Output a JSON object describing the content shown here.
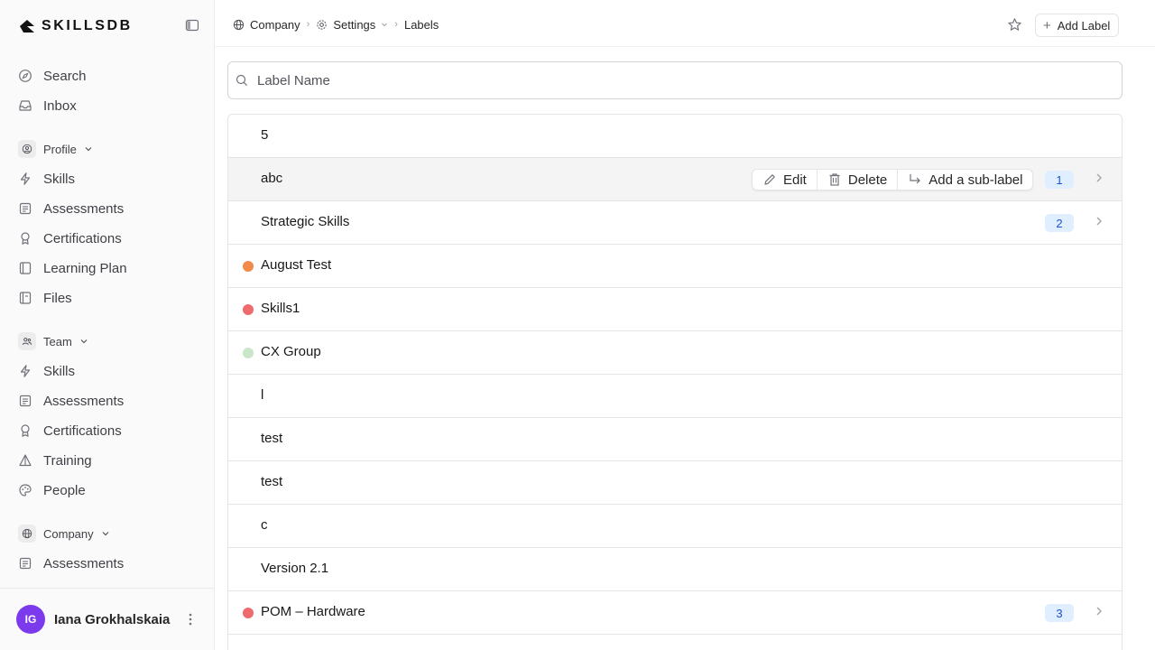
{
  "brand": {
    "logo_text": "SKILLSDB"
  },
  "sidebar": {
    "top_items": [
      {
        "label": "Search",
        "icon": "compass-icon"
      },
      {
        "label": "Inbox",
        "icon": "inbox-icon"
      }
    ],
    "profile": {
      "header": "Profile",
      "items": [
        {
          "label": "Skills",
          "icon": "bolt-icon"
        },
        {
          "label": "Assessments",
          "icon": "assessment-icon"
        },
        {
          "label": "Certifications",
          "icon": "award-icon"
        },
        {
          "label": "Learning Plan",
          "icon": "book-icon"
        },
        {
          "label": "Files",
          "icon": "file-icon"
        }
      ]
    },
    "team": {
      "header": "Team",
      "items": [
        {
          "label": "Skills",
          "icon": "bolt-icon"
        },
        {
          "label": "Assessments",
          "icon": "assessment-icon"
        },
        {
          "label": "Certifications",
          "icon": "award-icon"
        },
        {
          "label": "Training",
          "icon": "triangle-icon"
        },
        {
          "label": "People",
          "icon": "palette-icon"
        }
      ]
    },
    "company": {
      "header": "Company",
      "items": [
        {
          "label": "Assessments",
          "icon": "assessment-icon"
        }
      ]
    },
    "user": {
      "initials": "IG",
      "name": "Iana Grokhalskaia",
      "avatar_color": "#7c3aed"
    }
  },
  "header": {
    "breadcrumb": [
      "Company",
      "Settings",
      "Labels"
    ],
    "add_label": "Add Label"
  },
  "search": {
    "placeholder": "Label Name",
    "value": ""
  },
  "row_actions": {
    "edit": "Edit",
    "delete": "Delete",
    "add_sub": "Add a sub-label"
  },
  "labels": [
    {
      "name": "5",
      "color": null,
      "count": null
    },
    {
      "name": "abc",
      "color": null,
      "count": "1",
      "hovered": true
    },
    {
      "name": "Strategic Skills",
      "color": null,
      "count": "2"
    },
    {
      "name": "August Test",
      "color": "#f28a4a",
      "count": null
    },
    {
      "name": "Skills1",
      "color": "#f06b6b",
      "count": null
    },
    {
      "name": "CX Group",
      "color": "#c9e6c9",
      "count": null
    },
    {
      "name": "l",
      "color": null,
      "count": null
    },
    {
      "name": "test",
      "color": null,
      "count": null
    },
    {
      "name": "test",
      "color": null,
      "count": null
    },
    {
      "name": "c",
      "color": null,
      "count": null
    },
    {
      "name": "Version 2.1",
      "color": null,
      "count": null
    },
    {
      "name": "POM – Hardware",
      "color": "#f06b6b",
      "count": "3"
    }
  ]
}
